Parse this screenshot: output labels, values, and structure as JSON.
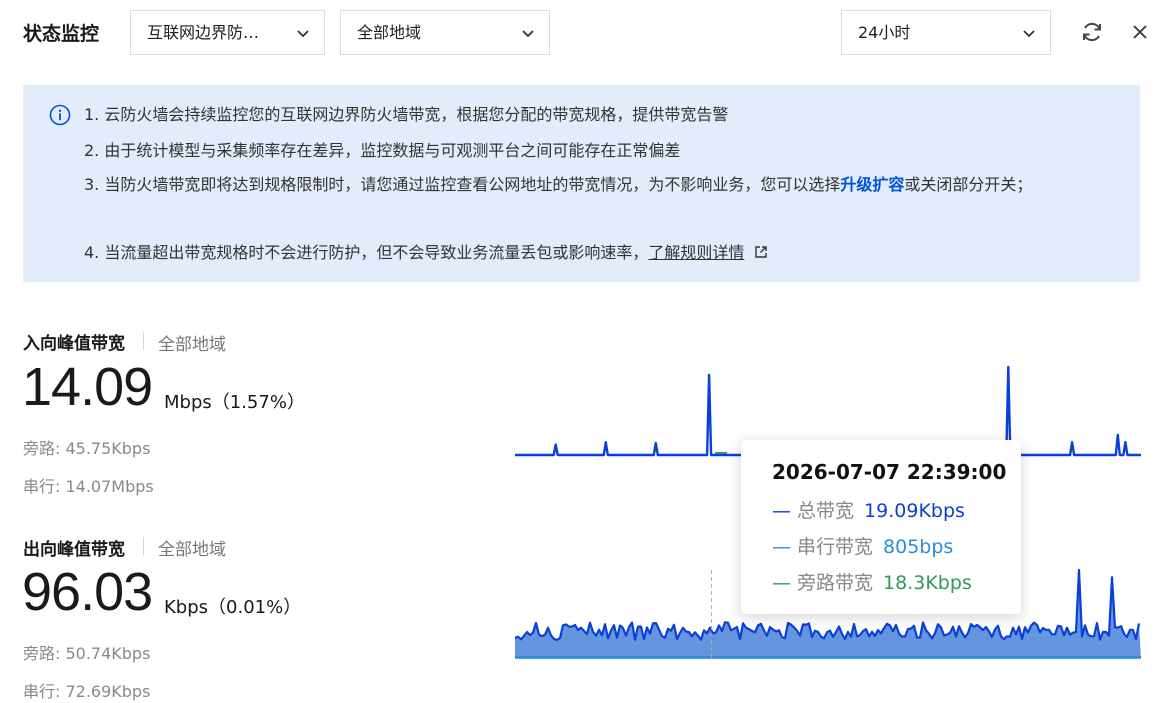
{
  "header": {
    "title": "状态监控",
    "instance_select": "互联网边界防…",
    "region_select": "全部地域",
    "time_select": "24小时"
  },
  "notice": {
    "line1": "1. 云防火墙会持续监控您的互联网边界防火墙带宽，根据您分配的带宽规格，提供带宽告警",
    "line2": "2. 由于统计模型与采集频率存在差异，监控数据与可观测平台之间可能存在正常偏差",
    "line3_prefix": "3. 当防火墙带宽即将达到规格限制时，请您通过监控查看公网地址的带宽情况，为不影响业务，您可以选择",
    "line3_link": "升级扩容",
    "line3_suffix": "或关闭部分开关；",
    "line4_prefix": "4. 当流量超出带宽规格时不会进行防护，但不会导致业务流量丢包或影响速率，",
    "line4_link": "了解规则详情"
  },
  "inbound": {
    "title": "入向峰值带宽",
    "region": "全部地域",
    "value": "14.09",
    "unit": "Mbps（1.57%）",
    "bypass": "旁路: 45.75Kbps",
    "serial": "串行: 14.07Mbps"
  },
  "outbound": {
    "title": "出向峰值带宽",
    "region": "全部地域",
    "value": "96.03",
    "unit": "Kbps（0.01%）",
    "bypass": "旁路: 50.74Kbps",
    "serial": "串行: 72.69Kbps"
  },
  "tooltip": {
    "time": "2026-07-07 22:39:00",
    "rows": [
      {
        "label": "— 总带宽",
        "value": "19.09Kbps"
      },
      {
        "label": "— 串行带宽",
        "value": "805bps"
      },
      {
        "label": "— 旁路带宽",
        "value": "18.3Kbps"
      }
    ]
  },
  "colors": {
    "total": "#0a3fd8",
    "serial": "#2a8fd6",
    "bypass": "#2e9a5c",
    "link": "#0052d9"
  },
  "chart_data": [
    {
      "type": "line",
      "title": "",
      "series": [
        {
          "name": "总带宽",
          "spikes": [
            [
              0.065,
              0.13
            ],
            [
              0.145,
              0.16
            ],
            [
              0.225,
              0.15
            ],
            [
              0.31,
              1.0
            ],
            [
              0.73,
              0.08
            ],
            [
              0.788,
              1.1
            ],
            [
              0.89,
              0.16
            ],
            [
              0.963,
              0.25
            ],
            [
              0.975,
              0.16
            ]
          ]
        }
      ]
    },
    {
      "type": "area",
      "title": "",
      "series": [
        {
          "name": "总带宽",
          "spikes": [
            [
              0.09,
              0.72
            ],
            [
              0.2,
              0.72
            ],
            [
              0.62,
              0.5
            ],
            [
              0.86,
              0.55
            ],
            [
              0.9,
              0.6
            ],
            [
              0.94,
              0.6
            ],
            [
              0.96,
              0.7
            ],
            [
              0.985,
              0.65
            ]
          ],
          "peaks": [
            [
              0.902,
              1.0
            ],
            [
              0.955,
              0.82
            ]
          ]
        }
      ],
      "cursor_x": 0.314
    }
  ]
}
